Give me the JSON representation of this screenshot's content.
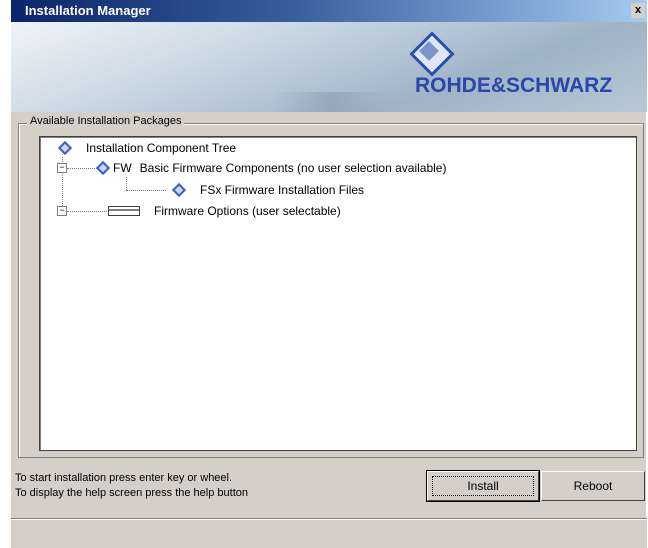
{
  "window": {
    "title": "Installation Manager",
    "close_glyph": "x",
    "brand": "ROHDE&SCHWARZ",
    "logo_icon": "rs-diamond-logo"
  },
  "packages": {
    "group_label": "Available Installation Packages",
    "tree": {
      "root": {
        "label": "Installation Component Tree",
        "icon": "diamond-icon"
      },
      "firmware": {
        "prefix": "FW",
        "label": "Basic Firmware Components (no user selection available)",
        "icon": "diamond-icon",
        "expander": "−",
        "children": [
          {
            "label": "FSx Firmware Installation Files",
            "icon": "diamond-icon"
          }
        ]
      },
      "options": {
        "label": "Firmware Options (user selectable)",
        "icon": "option-module-icon",
        "expander": "−"
      }
    }
  },
  "footer": {
    "line1": "To start installation press enter key or wheel.",
    "line2": "To display the help screen press the help button",
    "install_label": "Install",
    "reboot_label": "Reboot"
  },
  "colors": {
    "titlebar_start": "#0a246a",
    "brand_blue": "#2b46a8",
    "dialog_face": "#d4d0c8"
  }
}
